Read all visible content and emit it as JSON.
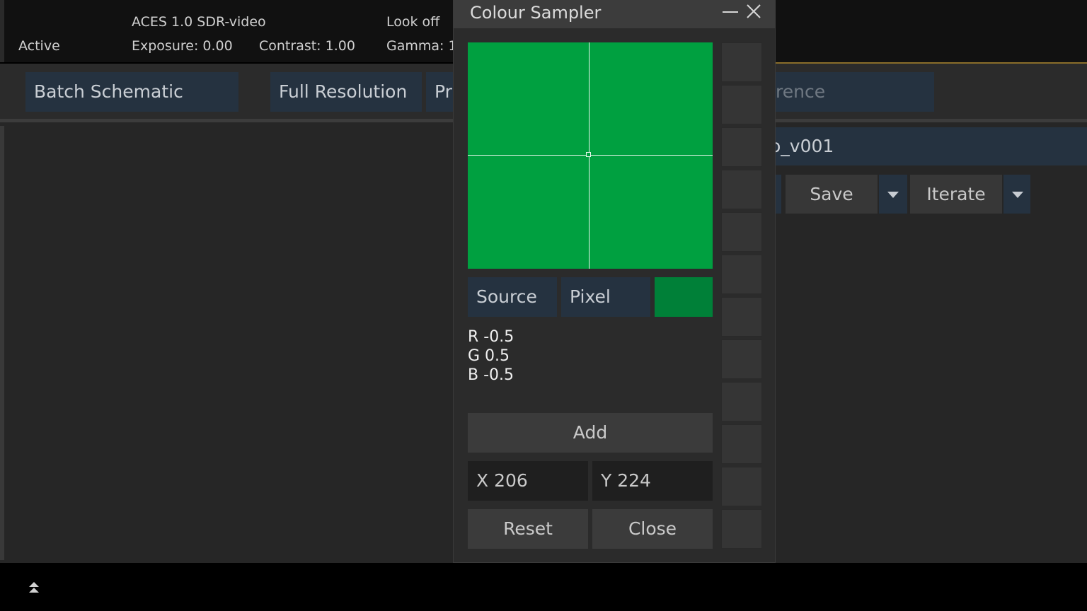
{
  "topbar": {
    "status": "Active",
    "colour_space": "ACES 1.0 SDR-video",
    "look": "Look off",
    "exposure": "Exposure: 0.00",
    "contrast": "Contrast: 1.00",
    "gamma": "Gamma: 1"
  },
  "toolbar": {
    "batch_schematic": "Batch Schematic",
    "full_resolution": "Full Resolution",
    "partial_left": "Pr",
    "partial_right": "rence"
  },
  "workspace": {
    "name_partial": "o_v001",
    "save_label": "Save",
    "iterate_label": "Iterate"
  },
  "dialog": {
    "title": "Colour Sampler",
    "source_label": "Source",
    "pixel_label": "Pixel",
    "sample_color": "#008038",
    "preview_color": "#00a040",
    "r_value": "R -0.5",
    "g_value": "G 0.5",
    "b_value": "B -0.5",
    "add_label": "Add",
    "x_value": "X 206",
    "y_value": "Y 224",
    "reset_label": "Reset",
    "close_label": "Close",
    "slot_count": 12
  },
  "icons": {
    "minimize": "minimize-icon",
    "close": "close-icon",
    "expand": "double-chevron-up-icon",
    "dropdown": "caret-down-icon"
  }
}
